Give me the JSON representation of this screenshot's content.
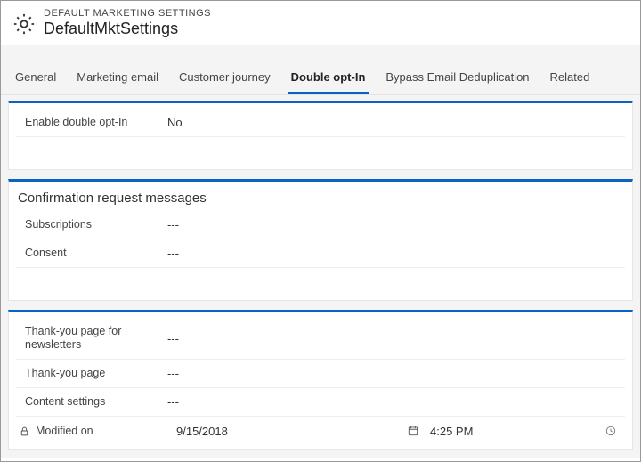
{
  "header": {
    "subtitle": "DEFAULT MARKETING SETTINGS",
    "title": "DefaultMktSettings"
  },
  "tabs": [
    {
      "label": "General"
    },
    {
      "label": "Marketing email"
    },
    {
      "label": "Customer journey"
    },
    {
      "label": "Double opt-In"
    },
    {
      "label": "Bypass Email Deduplication"
    },
    {
      "label": "Related"
    }
  ],
  "panel1": {
    "enable_double_opt_in": {
      "label": "Enable double opt-In",
      "value": "No"
    }
  },
  "panel2": {
    "title": "Confirmation request messages",
    "subscriptions": {
      "label": "Subscriptions",
      "value": "---"
    },
    "consent": {
      "label": "Consent",
      "value": "---"
    }
  },
  "panel3": {
    "thankyou_newsletters": {
      "label": "Thank-you page for newsletters",
      "value": "---"
    },
    "thankyou_page": {
      "label": "Thank-you page",
      "value": "---"
    },
    "content_settings": {
      "label": "Content settings",
      "value": "---"
    },
    "modified": {
      "label": "Modified on",
      "date": "9/15/2018",
      "time": "4:25 PM"
    }
  }
}
